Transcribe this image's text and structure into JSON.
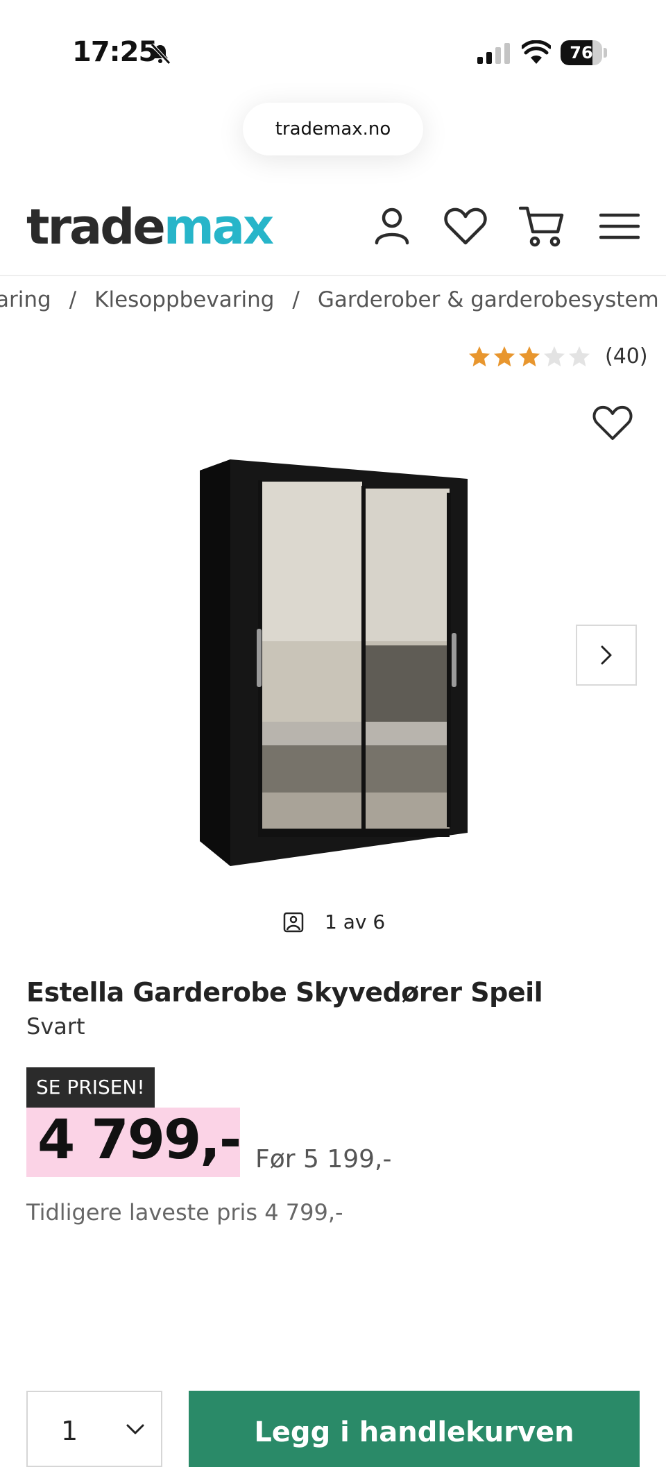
{
  "status_bar": {
    "time": "17:25",
    "battery": "76",
    "battery_level": 0.76
  },
  "browser": {
    "url": "trademax.no"
  },
  "header": {
    "logo_part1": "trade",
    "logo_part2": "max"
  },
  "breadcrumb": {
    "items": [
      "aring",
      "Klesoppbevaring",
      "Garderober & garderobesystem"
    ],
    "separator": "/"
  },
  "rating": {
    "value": 3,
    "max": 5,
    "count": "(40)"
  },
  "gallery": {
    "counter": "1 av 6"
  },
  "product": {
    "title": "Estella Garderobe Skyvedører Speil",
    "variant": "Svart",
    "badge": "SE PRISEN!",
    "price": "4 799,-",
    "old_price": "Før 5 199,-",
    "lowest_price": "Tidligere laveste pris 4 799,-"
  },
  "purchase": {
    "quantity": "1",
    "add_to_cart_label": "Legg i handlekurven"
  },
  "colors": {
    "brand_dark": "#2b2b2b",
    "brand_accent": "#27b5c9",
    "star": "#e8962e",
    "price_bg": "#fbd3e6",
    "cta": "#2a8a68"
  }
}
